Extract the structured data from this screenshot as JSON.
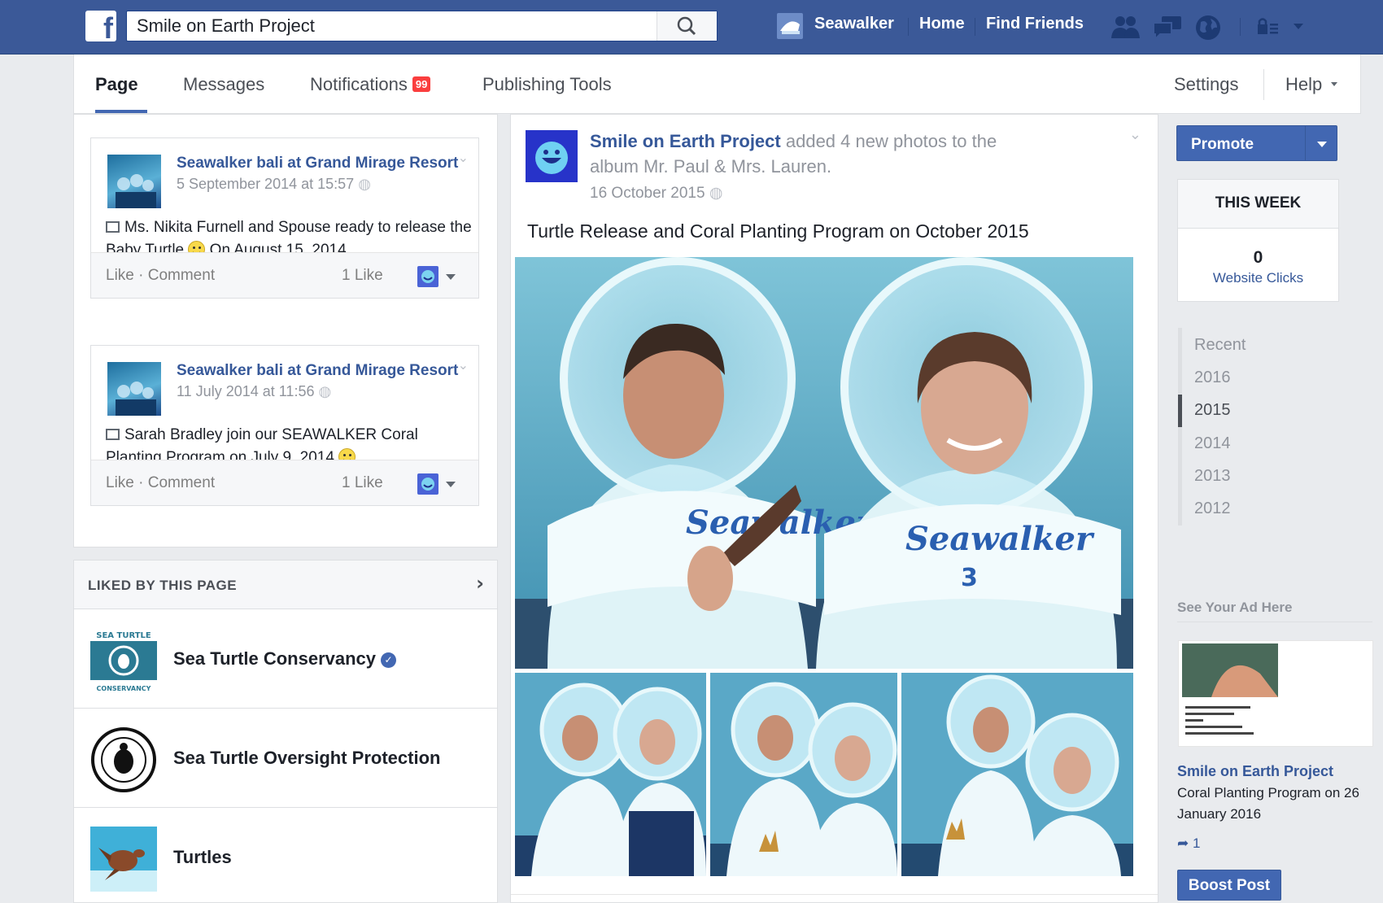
{
  "topbar": {
    "search_value": "Smile on Earth Project",
    "profile_name": "Seawalker",
    "home": "Home",
    "find_friends": "Find Friends",
    "brand_color": "#3b5998"
  },
  "tabs": {
    "page": "Page",
    "messages": "Messages",
    "notifications": "Notifications",
    "notifications_count": "99",
    "publishing_tools": "Publishing Tools",
    "settings": "Settings",
    "help": "Help"
  },
  "left_posts": [
    {
      "title": "Seawalker bali at Grand Mirage Resort",
      "date": "5 September 2014 at 15:57",
      "text_before": "Ms. Nikita Furnell and Spouse ready to release the Baby Turtle",
      "text_after": "On August 15, 2014",
      "actions": "Like · Comment",
      "likes": "1 Like"
    },
    {
      "title": "Seawalker bali at Grand Mirage Resort",
      "date": "11 July 2014 at 11:56",
      "text_before": "Sarah Bradley join our SEAWALKER Coral Planting Program on July 9, 2014",
      "text_after": "",
      "actions": "Like · Comment",
      "likes": "1 Like"
    }
  ],
  "liked_by": {
    "title": "LIKED BY THIS PAGE",
    "items": [
      {
        "name": "Sea Turtle Conservancy",
        "verified": true
      },
      {
        "name": "Sea Turtle Oversight Protection",
        "verified": false
      },
      {
        "name": "Turtles",
        "verified": false
      }
    ]
  },
  "post": {
    "page_name": "Smile on Earth Project",
    "action": "added 4 new photos to the album Mr. Paul & Mrs. Lauren.",
    "date": "16 October 2015",
    "text": "Turtle Release and Coral Planting Program on October 2015"
  },
  "right": {
    "promote": "Promote",
    "this_week": "THIS WEEK",
    "clicks_value": "0",
    "clicks_label": "Website Clicks",
    "years": [
      "Recent",
      "2016",
      "2015",
      "2014",
      "2013",
      "2012"
    ],
    "active_year": "2015",
    "ad_header": "See Your Ad Here",
    "ad_title": "Smile on Earth Project",
    "ad_desc": "Coral Planting Program on 26 January 2016",
    "ad_shares": "1",
    "boost": "Boost Post"
  }
}
